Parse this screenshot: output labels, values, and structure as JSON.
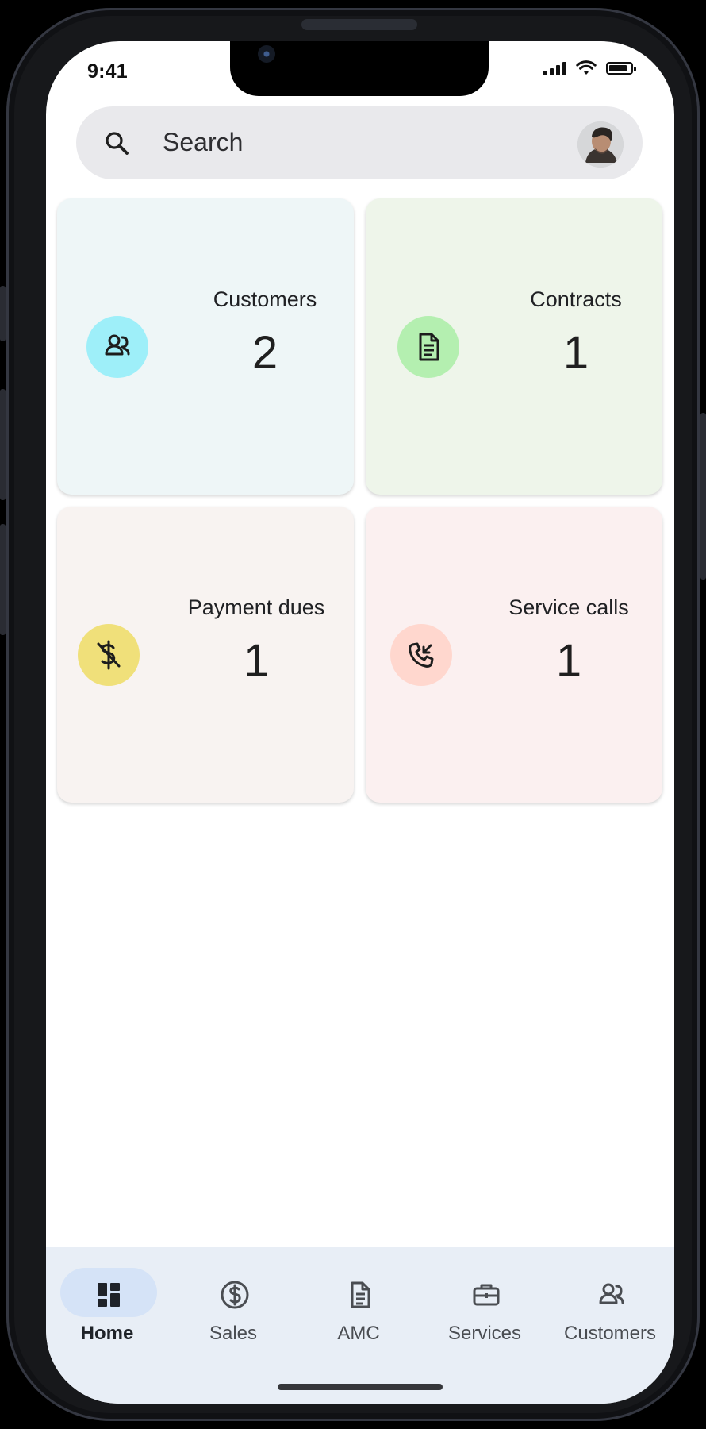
{
  "status_bar": {
    "time": "9:41",
    "icons": [
      "signal-icon",
      "wifi-icon",
      "battery-icon"
    ]
  },
  "search": {
    "label": "Search",
    "icon": "search-icon",
    "avatar": "avatar"
  },
  "dashboard": {
    "cards": [
      {
        "title": "Customers",
        "value": "2",
        "icon": "users-icon",
        "accent": "#9eeff9",
        "background": "#eef6f7"
      },
      {
        "title": "Contracts",
        "value": "1",
        "icon": "document-icon",
        "accent": "#b4efb0",
        "background": "#eef5ea"
      },
      {
        "title": "Payment dues",
        "value": "1",
        "icon": "no-dollar-icon",
        "accent": "#f0e07a",
        "background": "#f8f3f1"
      },
      {
        "title": "Service calls",
        "value": "1",
        "icon": "incoming-call-icon",
        "accent": "#ffd7ce",
        "background": "#fbf0f0"
      }
    ]
  },
  "bottom_nav": {
    "items": [
      {
        "label": "Home",
        "icon": "dashboard-icon",
        "active": true
      },
      {
        "label": "Sales",
        "icon": "dollar-circle-icon",
        "active": false
      },
      {
        "label": "AMC",
        "icon": "document-icon",
        "active": false
      },
      {
        "label": "Services",
        "icon": "briefcase-icon",
        "active": false
      },
      {
        "label": "Customers",
        "icon": "users-icon",
        "active": false
      }
    ],
    "active_color": "#d5e3f7"
  }
}
